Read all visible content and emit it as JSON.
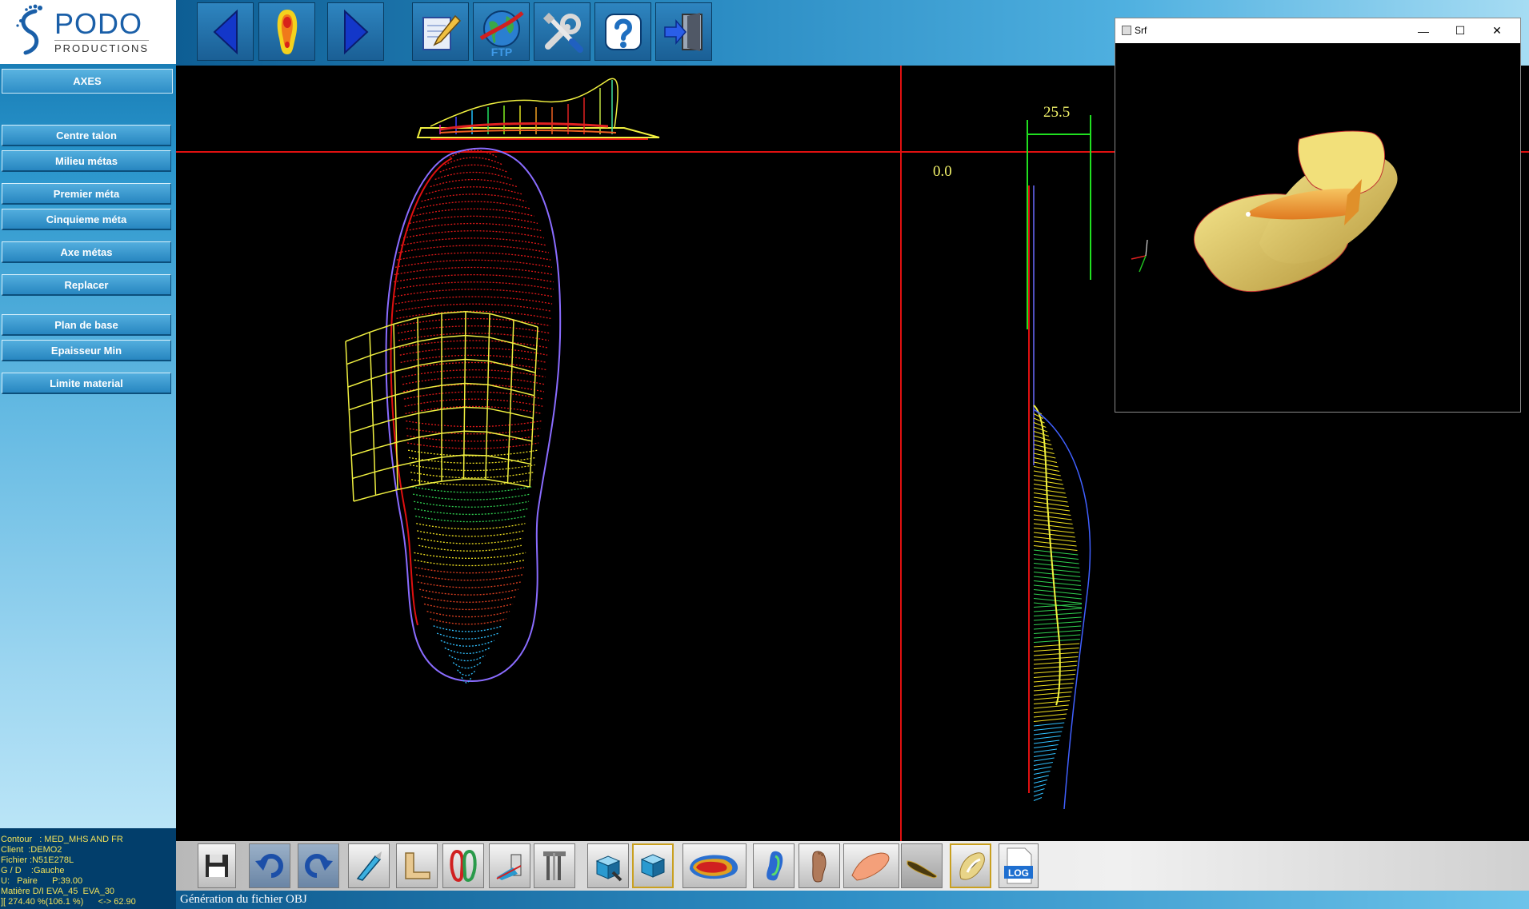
{
  "logo": {
    "name": "PODO",
    "tagline": "PRODUCTIONS"
  },
  "sidebar": {
    "title": "AXES",
    "buttons": [
      "Centre talon",
      "Milieu métas",
      "Premier méta",
      "Cinquieme méta",
      "Axe métas",
      "Replacer",
      "Plan de base",
      "Epaisseur Min",
      "Limite material"
    ]
  },
  "info": {
    "lines": [
      "Contour   : MED_MHS AND FR",
      "Client  :DEMO2",
      "Fichier :N51E278L",
      "G / D    :Gauche",
      "U:   Paire      P:39.00",
      "Matière D/I EVA_45  EVA_30",
      "][ 274.40 %(106.1 %)      <-> 62.90"
    ]
  },
  "toolbar": {
    "icons": [
      "arrow-left-icon",
      "foot-pressure-icon",
      "arrow-right-icon",
      "notepad-edit-icon",
      "ftp-globe-icon",
      "tools-icon",
      "help-icon",
      "exit-door-icon"
    ],
    "ftp_label": "FTP"
  },
  "bottom_toolbar": {
    "icons": [
      "save-icon",
      "undo-icon",
      "redo-icon",
      "scalpel-icon",
      "angle-icon",
      "insoles-icon",
      "profile-cut-icon",
      "caliper-icon",
      "cube-export-icon",
      "cube-icon",
      "pressure-map-icon",
      "foot-outline-icon",
      "foot-3d-icon",
      "shell-icon",
      "insole-side-icon",
      "insole-top-icon",
      "log-icon"
    ],
    "log_label": "LOG"
  },
  "viewport": {
    "label_zero": "0.0",
    "label_thickness": "25.5"
  },
  "status": {
    "text": "Génération du fichier OBJ"
  },
  "srf_window": {
    "title": "Srf",
    "minimize": "—",
    "maximize": "☐",
    "close": "✕"
  }
}
